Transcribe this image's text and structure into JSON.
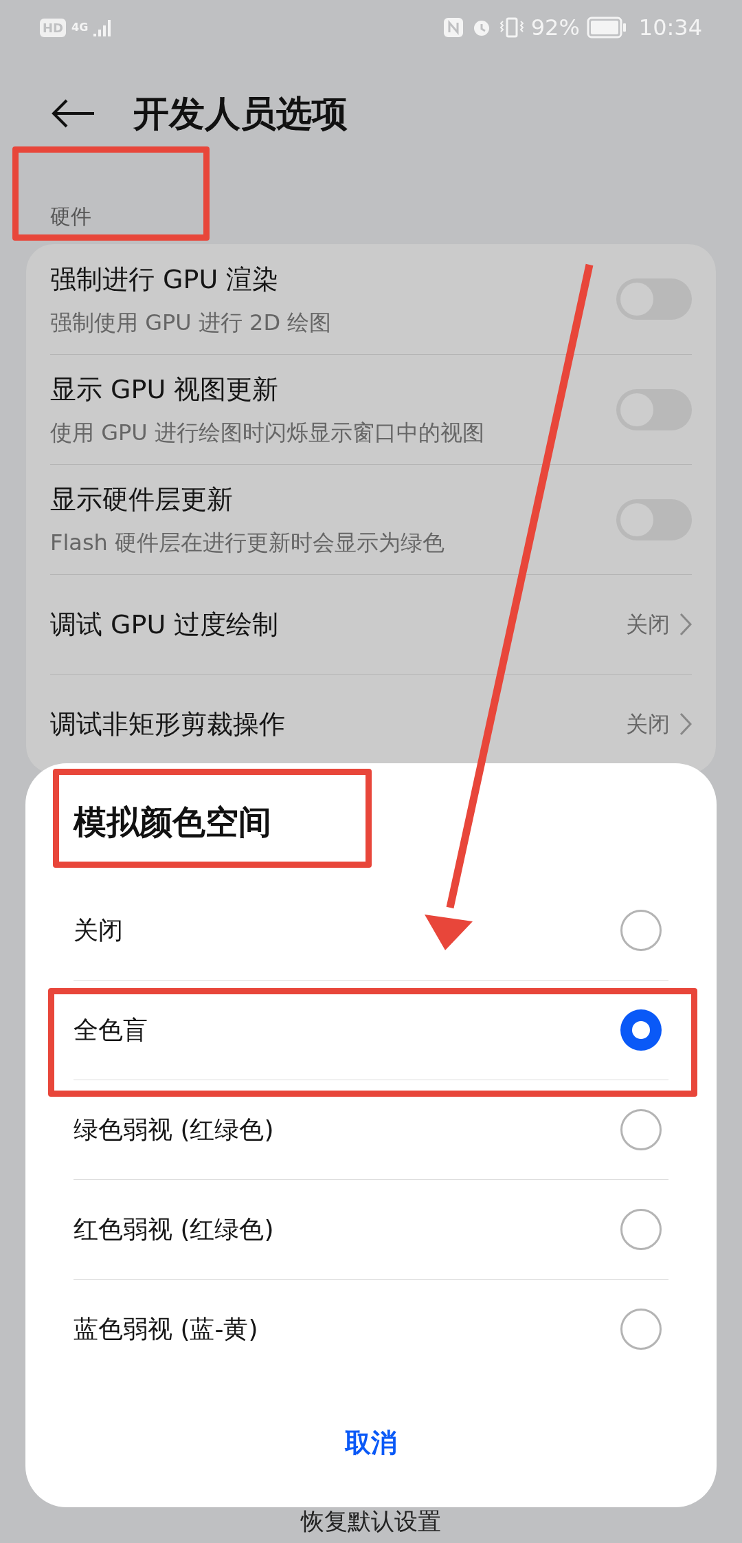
{
  "status_bar": {
    "hd": "HD",
    "network": "4G",
    "battery": "92%",
    "time": "10:34"
  },
  "header": {
    "title": "开发人员选项"
  },
  "section": {
    "label": "硬件"
  },
  "settings": [
    {
      "kind": "toggle",
      "title": "强制进行 GPU 渲染",
      "subtitle": "强制使用 GPU 进行 2D 绘图",
      "on": false
    },
    {
      "kind": "toggle",
      "title": "显示 GPU 视图更新",
      "subtitle": "使用 GPU 进行绘图时闪烁显示窗口中的视图",
      "on": false
    },
    {
      "kind": "toggle",
      "title": "显示硬件层更新",
      "subtitle": "Flash 硬件层在进行更新时会显示为绿色",
      "on": false
    },
    {
      "kind": "value",
      "title": "调试 GPU 过度绘制",
      "value": "关闭"
    },
    {
      "kind": "value",
      "title": "调试非矩形剪裁操作",
      "value": "关闭"
    }
  ],
  "footer": {
    "label": "恢复默认设置"
  },
  "dialog": {
    "title": "模拟颜色空间",
    "options": [
      {
        "label": "关闭",
        "selected": false
      },
      {
        "label": "全色盲",
        "selected": true
      },
      {
        "label": "绿色弱视 (红绿色)",
        "selected": false
      },
      {
        "label": "红色弱视 (红绿色)",
        "selected": false
      },
      {
        "label": "蓝色弱视 (蓝-黄)",
        "selected": false
      }
    ],
    "cancel": "取消"
  }
}
